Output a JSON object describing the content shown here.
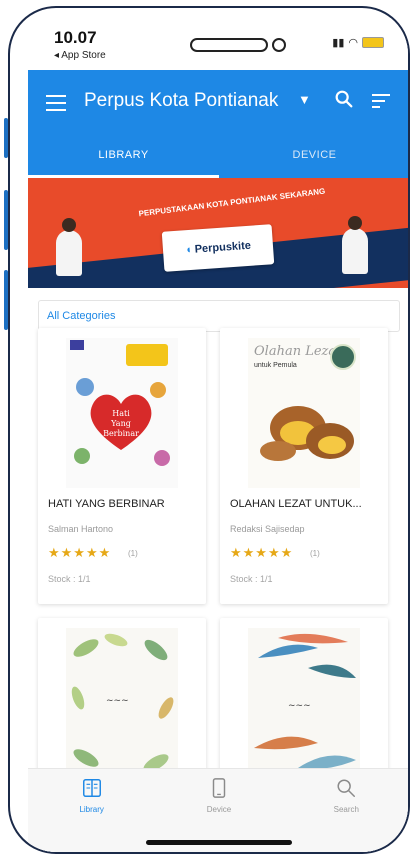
{
  "status_bar": {
    "time": "10.07",
    "back_label": "◂ App Store"
  },
  "app_bar": {
    "title": "Perpus Kota Pontianak",
    "icons": [
      "menu-icon",
      "dropdown-caret-icon",
      "search-icon",
      "filter-icon"
    ]
  },
  "tabs": [
    {
      "label": "LIBRARY",
      "active": true
    },
    {
      "label": "DEVICE",
      "active": false
    }
  ],
  "banner": {
    "heading": "PERPUSTAKAAN KOTA PONTIANAK SEKARANG",
    "logo_text": "Perpuskite"
  },
  "category": {
    "label": "All Categories"
  },
  "books": [
    {
      "title": "HATI YANG BERBINAR",
      "author": "Salman Hartono",
      "rating": "★★★★★",
      "rating_count": "(1)",
      "stock": "Stock : 1/1",
      "cover_text": "Hati Yang Berbinar"
    },
    {
      "title": "OLAHAN LEZAT UNTUK...",
      "author": "Redaksi Sajisedap",
      "rating": "★★★★★",
      "rating_count": "(1)",
      "stock": "Stock : 1/1",
      "cover_text": "Olahan Lezat",
      "cover_sub": "untuk Pemula"
    },
    {
      "title": "",
      "author": "",
      "rating": "",
      "rating_count": "",
      "stock": ""
    },
    {
      "title": "",
      "author": "",
      "rating": "",
      "rating_count": "",
      "stock": ""
    }
  ],
  "bottom_nav": [
    {
      "label": "Library",
      "icon": "book-icon",
      "active": true
    },
    {
      "label": "Device",
      "icon": "phone-icon",
      "active": false
    },
    {
      "label": "Search",
      "icon": "search-icon",
      "active": false
    }
  ],
  "colors": {
    "primary": "#1e88e5",
    "banner_orange": "#e84b2a",
    "banner_navy": "#12305f",
    "star": "#e6a817"
  }
}
